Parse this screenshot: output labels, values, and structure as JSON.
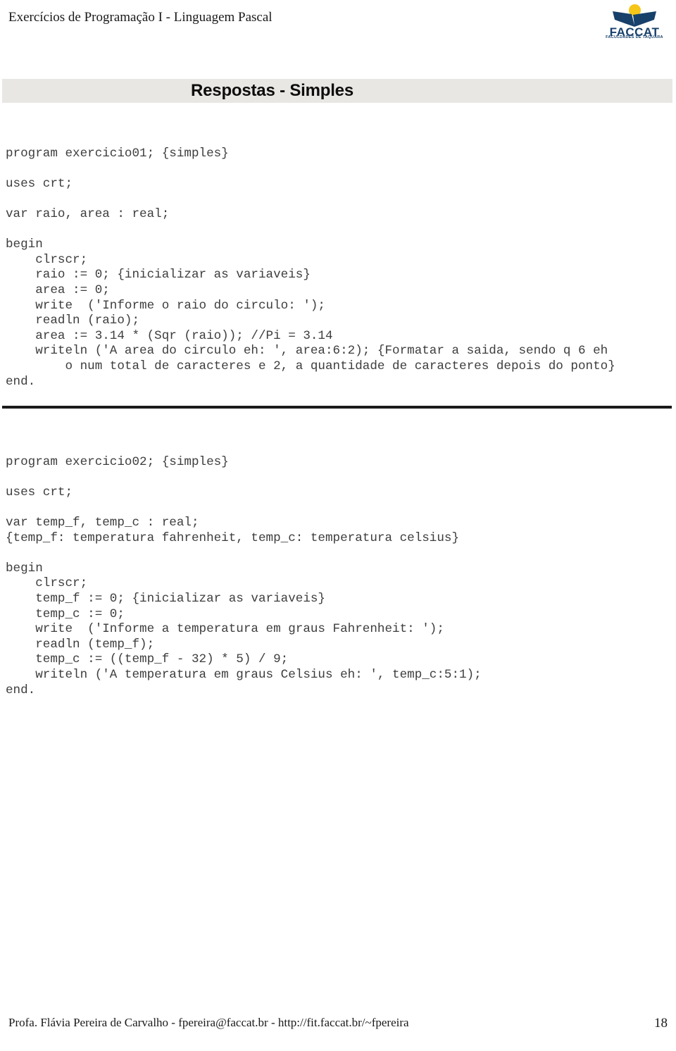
{
  "header": {
    "title": "Exercícios de Programação I - Linguagem Pascal",
    "logo": {
      "word": "FACCAT",
      "subtitle": "FACULDADES DE TAQUARA",
      "sun_color": "#f5c518",
      "book_color": "#17406b"
    }
  },
  "title_band": {
    "text": "Respostas - Simples",
    "background": "#e8e7e3"
  },
  "code_blocks": [
    {
      "id": "exercicio01",
      "lines": [
        "program exercicio01; {simples}",
        "",
        "uses crt;",
        "",
        "var raio, area : real;",
        "",
        "begin",
        "    clrscr;",
        "    raio := 0; {inicializar as variaveis}",
        "    area := 0;",
        "    write  ('Informe o raio do circulo: ');",
        "    readln (raio);",
        "    area := 3.14 * (Sqr (raio)); //Pi = 3.14",
        "    writeln ('A area do circulo eh: ', area:6:2); {Formatar a saida, sendo q 6 eh",
        "        o num total de caracteres e 2, a quantidade de caracteres depois do ponto}",
        "end."
      ]
    },
    {
      "id": "exercicio02",
      "lines": [
        "program exercicio02; {simples}",
        "",
        "uses crt;",
        "",
        "var temp_f, temp_c : real;",
        "{temp_f: temperatura fahrenheit, temp_c: temperatura celsius}",
        "",
        "begin",
        "    clrscr;",
        "    temp_f := 0; {inicializar as variaveis}",
        "    temp_c := 0;",
        "    write  ('Informe a temperatura em graus Fahrenheit: ');",
        "    readln (temp_f);",
        "    temp_c := ((temp_f - 32) * 5) / 9;",
        "    writeln ('A temperatura em graus Celsius eh: ', temp_c:5:1);",
        "end."
      ]
    }
  ],
  "footer": {
    "text": "Profa. Flávia Pereira de Carvalho - fpereira@faccat.br - http://fit.faccat.br/~fpereira",
    "page_number": "18"
  }
}
